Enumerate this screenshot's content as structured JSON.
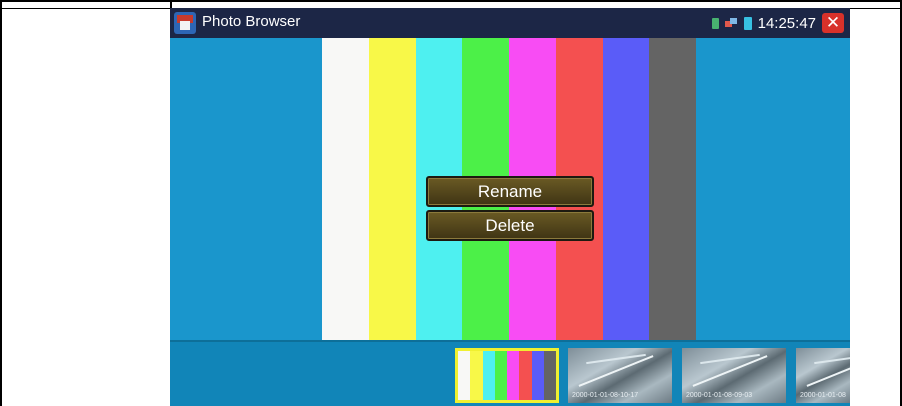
{
  "app": {
    "title": "Photo Browser",
    "icon": "home-icon",
    "clock": "14:25:47"
  },
  "status_icons": [
    "sd-card-icon",
    "network-icon",
    "battery-icon"
  ],
  "context_menu": {
    "items": [
      {
        "label": "Rename"
      },
      {
        "label": "Delete"
      }
    ]
  },
  "photo": {
    "type": "color-bars",
    "bars": [
      "#f8f8f6",
      "#f8f848",
      "#4ef0f0",
      "#4cf048",
      "#f84cf4",
      "#f45050",
      "#5a5cf8",
      "#646464"
    ]
  },
  "thumbnails": [
    {
      "type": "color-bars",
      "selected": true
    },
    {
      "type": "camera-image",
      "timestamp": "2000-01-01-08-10-17"
    },
    {
      "type": "camera-image",
      "timestamp": "2000-01-01-08-09-03"
    },
    {
      "type": "camera-image",
      "timestamp": "2000-01-01-08"
    }
  ],
  "colors": {
    "background": "#1a96cc",
    "titlebar": "#1c2646",
    "menu": "#4f4420",
    "close": "#d8312a",
    "selection": "#f0f030"
  }
}
